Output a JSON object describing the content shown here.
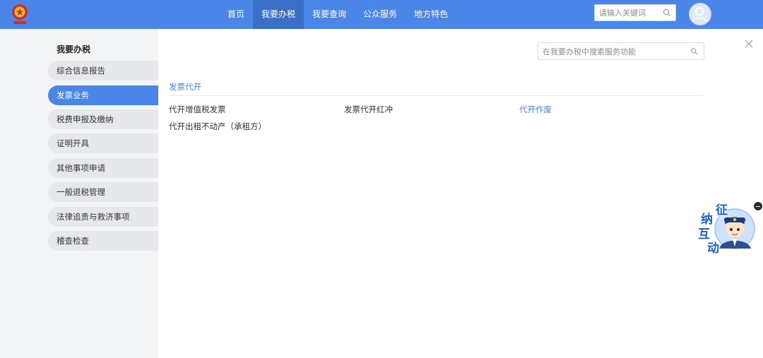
{
  "header": {
    "nav": [
      {
        "label": "首页",
        "active": false
      },
      {
        "label": "我要办税",
        "active": true
      },
      {
        "label": "我要查询",
        "active": false
      },
      {
        "label": "公众服务",
        "active": false
      },
      {
        "label": "地方特色",
        "active": false
      }
    ],
    "search": {
      "placeholder": "请输入关键词",
      "value": ""
    }
  },
  "sidebar": {
    "title": "我要办税",
    "items": [
      {
        "label": "综合信息报告",
        "active": false
      },
      {
        "label": "发票业务",
        "active": true
      },
      {
        "label": "税费申报及缴纳",
        "active": false
      },
      {
        "label": "证明开具",
        "active": false
      },
      {
        "label": "其他事项申请",
        "active": false
      },
      {
        "label": "一般退税管理",
        "active": false
      },
      {
        "label": "法律追责与救济事项",
        "active": false
      },
      {
        "label": "稽查检查",
        "active": false
      }
    ]
  },
  "main": {
    "search": {
      "placeholder": "在我要办税中搜索服务功能",
      "value": ""
    },
    "section": {
      "title": "发票代开",
      "items": [
        {
          "label": "代开增值税发票"
        },
        {
          "label": "发票代开红冲"
        },
        {
          "label": "代开作废"
        },
        {
          "label": "代开出租不动产（承租方）"
        }
      ]
    }
  },
  "widget": {
    "chars": [
      "征",
      "纳",
      "互",
      "动"
    ]
  },
  "colors": {
    "brand": "#4a86e8",
    "brand_dark": "#3a6fc8",
    "sidebar_bg": "#f3f4f6",
    "sidebar_item_bg": "#e6e8ec",
    "link": "#4a86e8"
  },
  "icons": {
    "logo": "tax-emblem-icon",
    "search": "search-icon",
    "avatar": "user-avatar-icon",
    "close": "close-icon",
    "collapse": "minus-circle-icon",
    "mascot": "customer-service-mascot-icon"
  }
}
